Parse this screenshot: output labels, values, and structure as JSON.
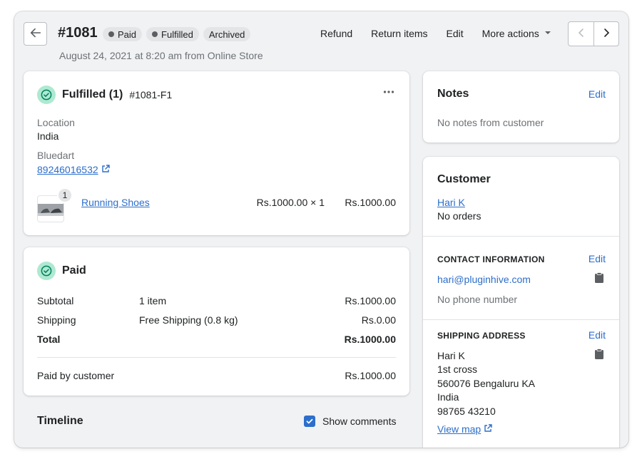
{
  "header": {
    "order_number": "#1081",
    "badges": [
      "Paid",
      "Fulfilled",
      "Archived"
    ],
    "subtitle": "August 24, 2021 at 8:20 am from Online Store",
    "actions": {
      "refund": "Refund",
      "return_items": "Return items",
      "edit": "Edit",
      "more_actions": "More actions"
    }
  },
  "fulfillment": {
    "title": "Fulfilled (1)",
    "fulfillment_id": "#1081-F1",
    "location_label": "Location",
    "location_value": "India",
    "carrier": "Bluedart",
    "tracking_number": "89246016532",
    "item": {
      "quantity_badge": "1",
      "name": "Running Shoes",
      "unit_price": "Rs.1000.00 × 1",
      "total": "Rs.1000.00"
    }
  },
  "payment": {
    "title": "Paid",
    "subtotal_label": "Subtotal",
    "subtotal_detail": "1 item",
    "subtotal_value": "Rs.1000.00",
    "shipping_label": "Shipping",
    "shipping_detail": "Free Shipping (0.8 kg)",
    "shipping_value": "Rs.0.00",
    "total_label": "Total",
    "total_value": "Rs.1000.00",
    "paid_label": "Paid by customer",
    "paid_value": "Rs.1000.00"
  },
  "timeline": {
    "title": "Timeline",
    "show_comments_label": "Show comments"
  },
  "notes": {
    "title": "Notes",
    "edit": "Edit",
    "empty": "No notes from customer"
  },
  "customer": {
    "title": "Customer",
    "name": "Hari K",
    "orders": "No orders",
    "contact_title": "CONTACT INFORMATION",
    "contact_edit": "Edit",
    "email": "hari@pluginhive.com",
    "phone": "No phone number",
    "shipping_title": "SHIPPING ADDRESS",
    "shipping_edit": "Edit",
    "address_lines": [
      "Hari K",
      "1st cross",
      "560076 Bengaluru KA",
      "India",
      "98765 43210"
    ],
    "view_map": "View map"
  },
  "colors": {
    "link": "#2c6ecb",
    "success_bg": "#aee9d1",
    "success_icon": "#007f5f",
    "badge_bg": "#e4e5e7"
  }
}
